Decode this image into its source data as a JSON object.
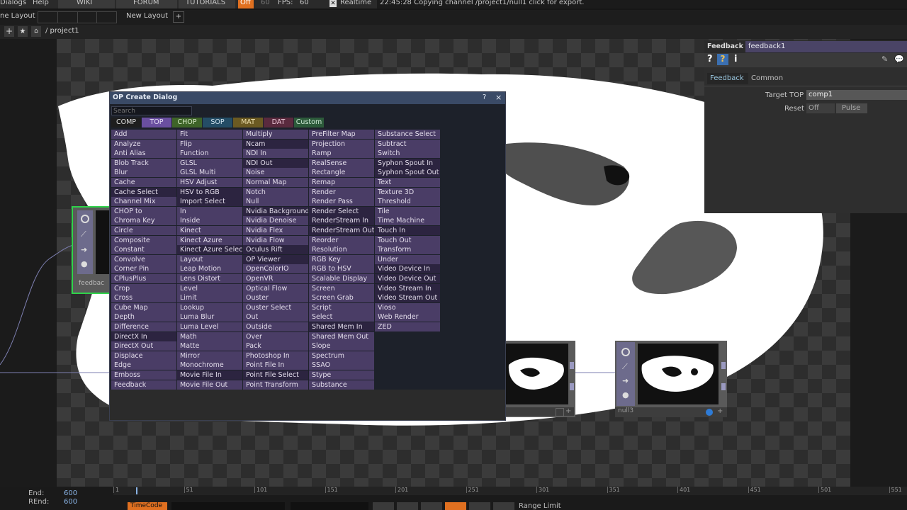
{
  "menubar": {
    "dialogs": "Dialogs",
    "help": "Help",
    "wiki": "WIKI",
    "forum": "FORUM",
    "tutorials": "TUTORIALS",
    "on": "Off",
    "fps_target": "60",
    "fps_label": "FPS:",
    "fps_value": "60",
    "realtime": "Realtime",
    "status": "22:45:28 Copying channel /project1/null1 click for export."
  },
  "layoutbar": {
    "label": "ne Layout",
    "new_layout": "New Layout",
    "plus": "+"
  },
  "pathbar": {
    "path": "/ project1"
  },
  "network": {
    "nodes": [
      {
        "name": "feedbac"
      },
      {
        "name": ""
      },
      {
        "name": "null3"
      }
    ]
  },
  "params": {
    "op_type": "Feedback",
    "op_name": "feedback1",
    "tabs": [
      "Feedback",
      "Common"
    ],
    "target_label": "Target TOP",
    "target_value": "comp1",
    "reset_label": "Reset",
    "reset_value": "Off",
    "pulse": "Pulse"
  },
  "dialog": {
    "title": "OP Create Dialog",
    "help": "?",
    "close": "×",
    "search_placeholder": "Search",
    "tabs": [
      {
        "label": "COMP",
        "bg": "#1e1e1e",
        "fg": "#e0e0e0"
      },
      {
        "label": "TOP",
        "bg": "#6a4fa0",
        "fg": "#e8e0f8"
      },
      {
        "label": "CHOP",
        "bg": "#3e6428",
        "fg": "#d8ecc8"
      },
      {
        "label": "SOP",
        "bg": "#244d66",
        "fg": "#cfe2ee"
      },
      {
        "label": "MAT",
        "bg": "#6b5a22",
        "fg": "#efe2b0"
      },
      {
        "label": "DAT",
        "bg": "#5a2a3e",
        "fg": "#eec8d8"
      },
      {
        "label": "Custom",
        "bg": "#2c5a3a",
        "fg": "#d0ecd8"
      }
    ],
    "columns": [
      [
        "Add",
        "Analyze",
        "Anti Alias",
        "Blob Track",
        "Blur",
        "Cache",
        "Cache Select",
        "Channel Mix",
        "CHOP to",
        "Chroma Key",
        "Circle",
        "Composite",
        "Constant",
        "Convolve",
        "Corner Pin",
        "CPlusPlus",
        "Crop",
        "Cross",
        "Cube Map",
        "Depth",
        "Difference",
        "DirectX In",
        "DirectX Out",
        "Displace",
        "Edge",
        "Emboss",
        "Feedback"
      ],
      [
        "Fit",
        "Flip",
        "Function",
        "GLSL",
        "GLSL Multi",
        "HSV Adjust",
        "HSV to RGB",
        "Import Select",
        "In",
        "Inside",
        "Kinect",
        "Kinect Azure",
        "Kinect Azure Select",
        "Layout",
        "Leap Motion",
        "Lens Distort",
        "Level",
        "Limit",
        "Lookup",
        "Luma Blur",
        "Luma Level",
        "Math",
        "Matte",
        "Mirror",
        "Monochrome",
        "Movie File In",
        "Movie File Out"
      ],
      [
        "Multiply",
        "Ncam",
        "NDI In",
        "NDI Out",
        "Noise",
        "Normal Map",
        "Notch",
        "Null",
        "Nvidia Background",
        "Nvidia Denoise",
        "Nvidia Flex",
        "Nvidia Flow",
        "Oculus Rift",
        "OP Viewer",
        "OpenColorIO",
        "OpenVR",
        "Optical Flow",
        "Ouster",
        "Ouster Select",
        "Out",
        "Outside",
        "Over",
        "Pack",
        "Photoshop In",
        "Point File In",
        "Point File Select",
        "Point Transform"
      ],
      [
        "PreFilter Map",
        "Projection",
        "Ramp",
        "RealSense",
        "Rectangle",
        "Remap",
        "Render",
        "Render Pass",
        "Render Select",
        "RenderStream In",
        "RenderStream Out",
        "Reorder",
        "Resolution",
        "RGB Key",
        "RGB to HSV",
        "Scalable Display",
        "Screen",
        "Screen Grab",
        "Script",
        "Select",
        "Shared Mem In",
        "Shared Mem Out",
        "Slope",
        "Spectrum",
        "SSAO",
        "Stype",
        "Substance"
      ],
      [
        "Substance Select",
        "Subtract",
        "Switch",
        "Syphon Spout In",
        "Syphon Spout Out",
        "Text",
        "Texture 3D",
        "Threshold",
        "Tile",
        "Time Machine",
        "Touch In",
        "Touch Out",
        "Transform",
        "Under",
        "Video Device In",
        "Video Device Out",
        "Video Stream In",
        "Video Stream Out",
        "Vioso",
        "Web Render",
        "ZED"
      ]
    ],
    "dark_items": [
      "Cache Select",
      "DirectX In",
      "HSV to RGB",
      "Import Select",
      "Kinect Azure Select",
      "Movie File In",
      "Ncam",
      "NDI Out",
      "Nvidia Background",
      "Oculus Rift",
      "OP Viewer",
      "Point File Select",
      "Render Select",
      "RenderStream In",
      "RenderStream Out",
      "Shared Mem In",
      "Syphon Spout In",
      "Syphon Spout Out",
      "Touch In",
      "Video Device In",
      "Video Device Out",
      "Video Stream In",
      "Video Stream Out"
    ]
  },
  "timeline": {
    "end_label": "End:",
    "end_value": "600",
    "rend_label": "REnd:",
    "rend_value": "600",
    "ticks": [
      "1",
      "51",
      "101",
      "151",
      "201",
      "251",
      "301",
      "351",
      "401",
      "451",
      "501",
      "551"
    ],
    "timecode": "TimeCode",
    "range_limit": "Range Limit"
  },
  "colors": {
    "dialog_item_bg": "#4a3d66",
    "dialog_item_dark": "#2c2440",
    "accent_green": "#2fd34a",
    "title_bar": "#3a4a66"
  }
}
